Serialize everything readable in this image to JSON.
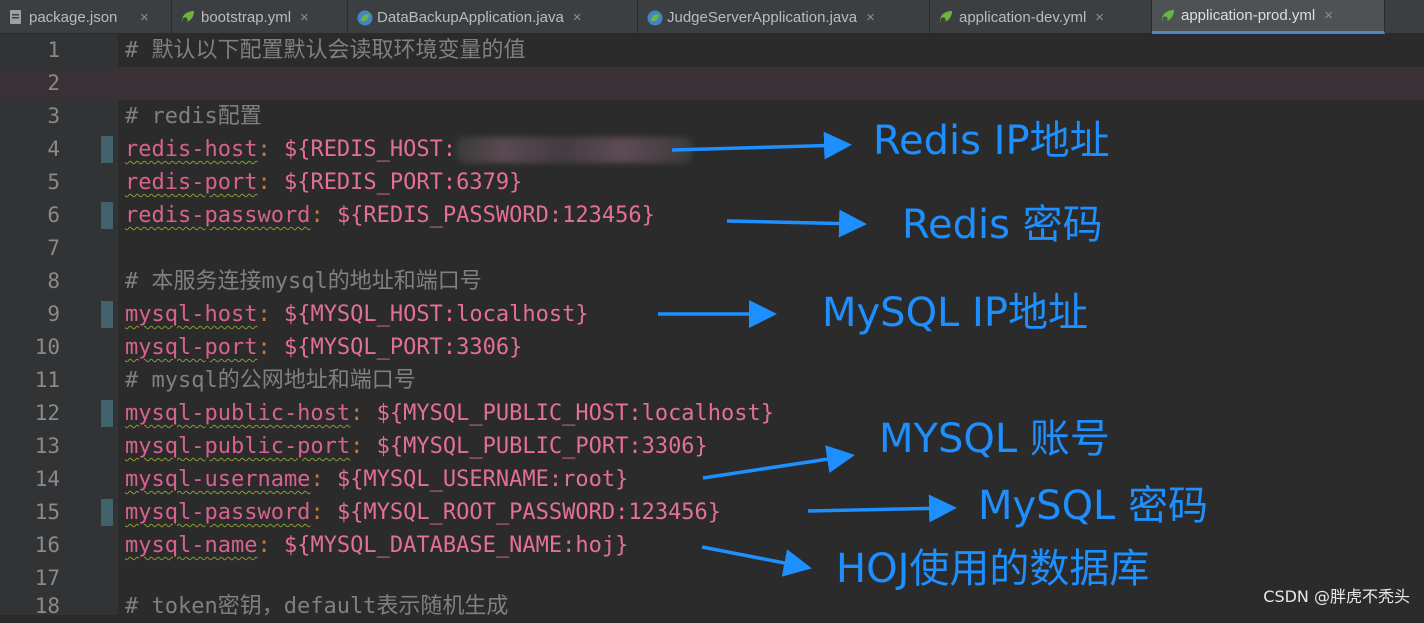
{
  "tabs": [
    {
      "label": "package.json",
      "icon": "json-file-icon",
      "active": false
    },
    {
      "label": "bootstrap.yml",
      "icon": "spring-yaml-icon",
      "active": false
    },
    {
      "label": "DataBackupApplication.java",
      "icon": "spring-boot-app-icon",
      "active": false
    },
    {
      "label": "JudgeServerApplication.java",
      "icon": "spring-boot-app-icon",
      "active": false
    },
    {
      "label": "application-dev.yml",
      "icon": "spring-yaml-icon",
      "active": false
    },
    {
      "label": "application-prod.yml",
      "icon": "spring-yaml-icon",
      "active": true
    }
  ],
  "close_glyph": "×",
  "editor": {
    "lines": [
      {
        "n": "1",
        "comment": "# 默认以下配置默认会读取环境变量的值"
      },
      {
        "n": "2",
        "comment": ""
      },
      {
        "n": "3",
        "comment": "# redis配置"
      },
      {
        "n": "4",
        "key": "redis-host",
        "sep": ": ",
        "value": "${REDIS_HOST:",
        "redacted": true
      },
      {
        "n": "5",
        "key": "redis-port",
        "sep": ": ",
        "value": "${REDIS_PORT:6379}"
      },
      {
        "n": "6",
        "key": "redis-password",
        "sep": ": ",
        "value": "${REDIS_PASSWORD:123456}"
      },
      {
        "n": "7",
        "comment": ""
      },
      {
        "n": "8",
        "comment": "# 本服务连接mysql的地址和端口号"
      },
      {
        "n": "9",
        "key": "mysql-host",
        "sep": ": ",
        "value": "${MYSQL_HOST:localhost}"
      },
      {
        "n": "10",
        "key": "mysql-port",
        "sep": ": ",
        "value": "${MYSQL_PORT:3306}"
      },
      {
        "n": "11",
        "comment": "# mysql的公网地址和端口号"
      },
      {
        "n": "12",
        "key": "mysql-public-host",
        "sep": ": ",
        "value": "${MYSQL_PUBLIC_HOST:localhost}"
      },
      {
        "n": "13",
        "key": "mysql-public-port",
        "sep": ": ",
        "value": "${MYSQL_PUBLIC_PORT:3306}"
      },
      {
        "n": "14",
        "key": "mysql-username",
        "sep": ": ",
        "value": "${MYSQL_USERNAME:root}"
      },
      {
        "n": "15",
        "key": "mysql-password",
        "sep": ": ",
        "value": "${MYSQL_ROOT_PASSWORD:123456}"
      },
      {
        "n": "16",
        "key": "mysql-name",
        "sep": ": ",
        "value": "${MYSQL_DATABASE_NAME:hoj}"
      },
      {
        "n": "17",
        "comment": ""
      },
      {
        "n": "18",
        "comment": "# token密钥，default表示随机生成"
      }
    ]
  },
  "annotations": [
    {
      "text": "Redis IP地址"
    },
    {
      "text": "Redis 密码"
    },
    {
      "text": "MySQL IP地址"
    },
    {
      "text": "MYSQL 账号"
    },
    {
      "text": "MySQL 密码"
    },
    {
      "text": "HOJ使用的数据库"
    }
  ],
  "watermark": "CSDN @胖虎不秃头",
  "colors": {
    "annotation": "#1e8fff",
    "active_tab_underline": "#4a88c7",
    "background": "#2b2b2b"
  }
}
